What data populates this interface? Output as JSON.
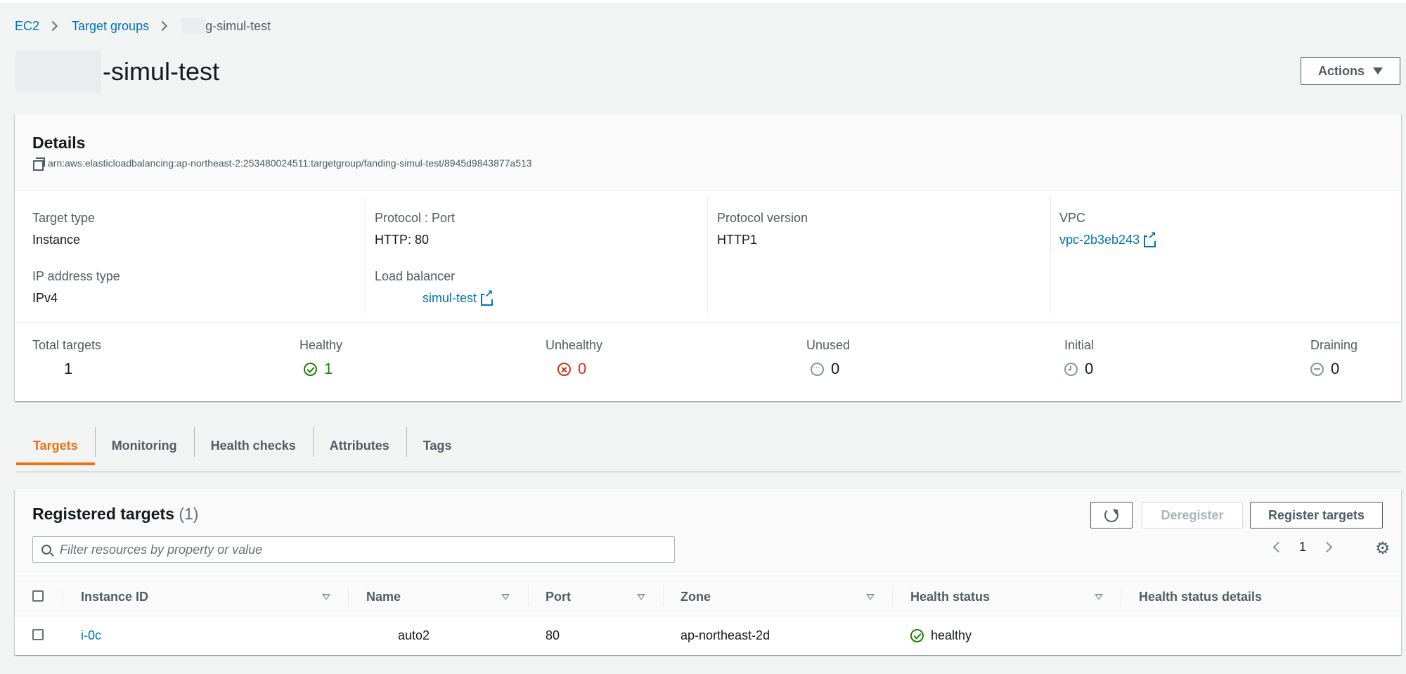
{
  "breadcrumb": {
    "items": [
      "EC2",
      "Target groups"
    ],
    "current": "-simul-test",
    "current_visible": "g-simul-test"
  },
  "page": {
    "title": "-simul-test"
  },
  "actions": {
    "label": "Actions"
  },
  "details": {
    "title": "Details",
    "arn": "arn:aws:elasticloadbalancing:ap-northeast-2:253480024511:targetgroup/fanding-simul-test/8945d9843877a513",
    "target_type": {
      "label": "Target type",
      "value": "Instance"
    },
    "protocol_port": {
      "label": "Protocol : Port",
      "value": "HTTP: 80"
    },
    "protocol_version": {
      "label": "Protocol version",
      "value": "HTTP1"
    },
    "vpc": {
      "label": "VPC",
      "value": "vpc-2b3eb243"
    },
    "ip_address_type": {
      "label": "IP address type",
      "value": "IPv4"
    },
    "load_balancer": {
      "label": "Load balancer",
      "value": "simul-test"
    }
  },
  "counts": {
    "total": {
      "label": "Total targets",
      "value": "1"
    },
    "healthy": {
      "label": "Healthy",
      "value": "1"
    },
    "unhealthy": {
      "label": "Unhealthy",
      "value": "0"
    },
    "unused": {
      "label": "Unused",
      "value": "0"
    },
    "initial": {
      "label": "Initial",
      "value": "0"
    },
    "draining": {
      "label": "Draining",
      "value": "0"
    }
  },
  "tabs": [
    "Targets",
    "Monitoring",
    "Health checks",
    "Attributes",
    "Tags"
  ],
  "registered": {
    "title": "Registered targets",
    "count": "(1)",
    "deregister_label": "Deregister",
    "register_label": "Register targets",
    "filter_placeholder": "Filter resources by property or value",
    "page": "1",
    "columns": [
      "Instance ID",
      "Name",
      "Port",
      "Zone",
      "Health status",
      "Health status details"
    ],
    "rows": [
      {
        "instance_id": "i-0c",
        "name": "auto2",
        "port": "80",
        "zone": "ap-northeast-2d",
        "health": "healthy",
        "details": ""
      }
    ]
  },
  "colors": {
    "link": "#0073bb",
    "active_tab": "#ec7211",
    "healthy": "#1d8102",
    "unhealthy": "#d13212"
  }
}
